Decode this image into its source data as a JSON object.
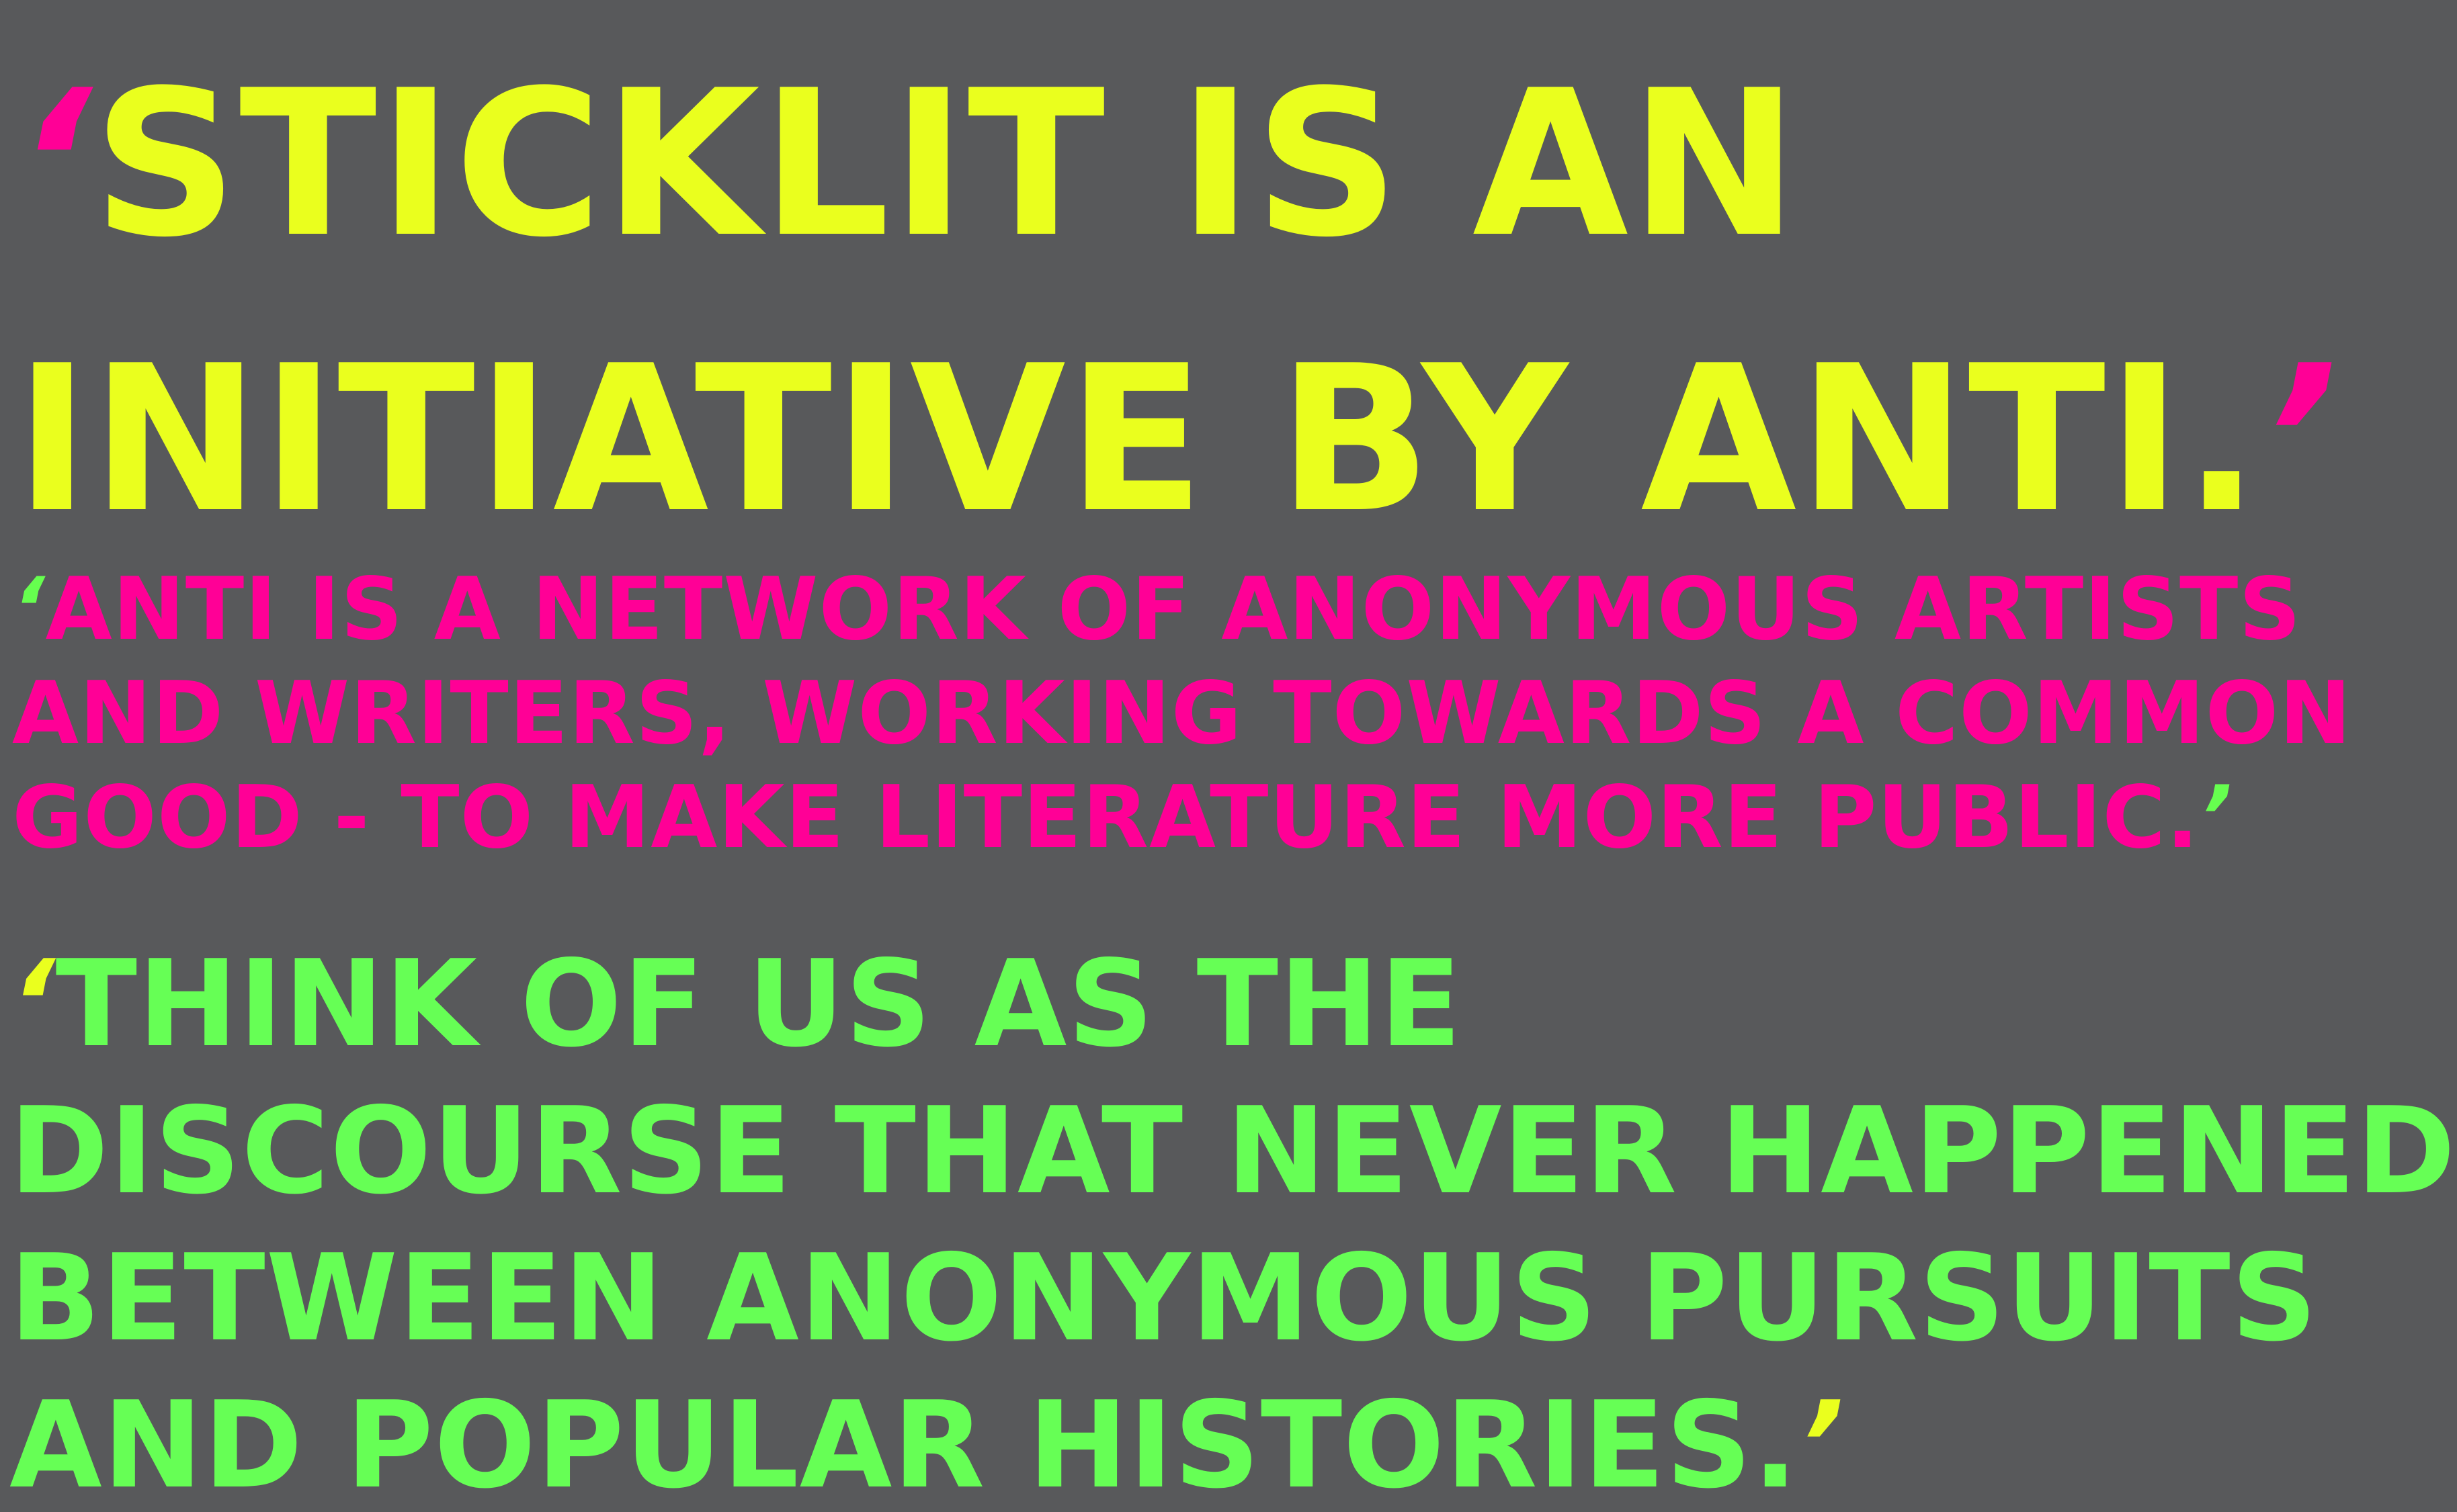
{
  "colors": {
    "background": "#58595b",
    "yellow": "#eaff1e",
    "pink": "#ff0096",
    "green": "#66ff55"
  },
  "quote_mark": "‘",
  "closing_quote_mark": "’",
  "statements": [
    {
      "lines": [
        "STICKLIT IS AN",
        "INITIATIVE BY ANTI."
      ]
    },
    {
      "lines": [
        "ANTI IS A NETWORK OF ANONYMOUS ARTISTS",
        "AND WRITERS, WORKING TOWARDS A COMMON",
        "GOOD - TO MAKE LITERATURE MORE PUBLIC."
      ]
    },
    {
      "lines": [
        "THINK OF US AS THE",
        "DISCOURSE THAT NEVER HAPPENED.",
        "BETWEEN ANONYMOUS PURSUITS",
        "AND POPULAR HISTORIES."
      ]
    }
  ]
}
